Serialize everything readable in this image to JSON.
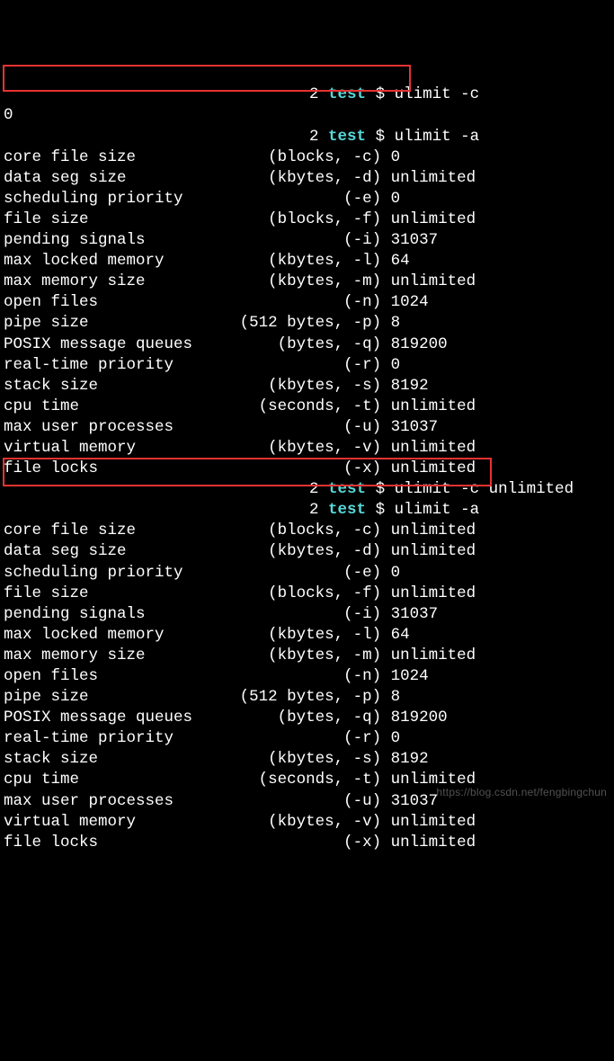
{
  "prompt": {
    "num": "2",
    "dir": "test",
    "sep": "$"
  },
  "commands": {
    "ulimit_c": "ulimit -c",
    "ulimit_a": "ulimit -a",
    "ulimit_c_unlimited": "ulimit -c unlimited"
  },
  "output0": "0",
  "limits1": [
    {
      "label": "core file size",
      "unit": "(blocks, -c)",
      "value": "0"
    },
    {
      "label": "data seg size",
      "unit": "(kbytes, -d)",
      "value": "unlimited"
    },
    {
      "label": "scheduling priority",
      "unit": "(-e)",
      "value": "0"
    },
    {
      "label": "file size",
      "unit": "(blocks, -f)",
      "value": "unlimited"
    },
    {
      "label": "pending signals",
      "unit": "(-i)",
      "value": "31037"
    },
    {
      "label": "max locked memory",
      "unit": "(kbytes, -l)",
      "value": "64"
    },
    {
      "label": "max memory size",
      "unit": "(kbytes, -m)",
      "value": "unlimited"
    },
    {
      "label": "open files",
      "unit": "(-n)",
      "value": "1024"
    },
    {
      "label": "pipe size",
      "unit": "(512 bytes, -p)",
      "value": "8"
    },
    {
      "label": "POSIX message queues",
      "unit": "(bytes, -q)",
      "value": "819200"
    },
    {
      "label": "real-time priority",
      "unit": "(-r)",
      "value": "0"
    },
    {
      "label": "stack size",
      "unit": "(kbytes, -s)",
      "value": "8192"
    },
    {
      "label": "cpu time",
      "unit": "(seconds, -t)",
      "value": "unlimited"
    },
    {
      "label": "max user processes",
      "unit": "(-u)",
      "value": "31037"
    },
    {
      "label": "virtual memory",
      "unit": "(kbytes, -v)",
      "value": "unlimited"
    },
    {
      "label": "file locks",
      "unit": "(-x)",
      "value": "unlimited"
    }
  ],
  "limits2": [
    {
      "label": "core file size",
      "unit": "(blocks, -c)",
      "value": "unlimited"
    },
    {
      "label": "data seg size",
      "unit": "(kbytes, -d)",
      "value": "unlimited"
    },
    {
      "label": "scheduling priority",
      "unit": "(-e)",
      "value": "0"
    },
    {
      "label": "file size",
      "unit": "(blocks, -f)",
      "value": "unlimited"
    },
    {
      "label": "pending signals",
      "unit": "(-i)",
      "value": "31037"
    },
    {
      "label": "max locked memory",
      "unit": "(kbytes, -l)",
      "value": "64"
    },
    {
      "label": "max memory size",
      "unit": "(kbytes, -m)",
      "value": "unlimited"
    },
    {
      "label": "open files",
      "unit": "(-n)",
      "value": "1024"
    },
    {
      "label": "pipe size",
      "unit": "(512 bytes, -p)",
      "value": "8"
    },
    {
      "label": "POSIX message queues",
      "unit": "(bytes, -q)",
      "value": "819200"
    },
    {
      "label": "real-time priority",
      "unit": "(-r)",
      "value": "0"
    },
    {
      "label": "stack size",
      "unit": "(kbytes, -s)",
      "value": "8192"
    },
    {
      "label": "cpu time",
      "unit": "(seconds, -t)",
      "value": "unlimited"
    },
    {
      "label": "max user processes",
      "unit": "(-u)",
      "value": "31037"
    },
    {
      "label": "virtual memory",
      "unit": "(kbytes, -v)",
      "value": "unlimited"
    },
    {
      "label": "file locks",
      "unit": "(-x)",
      "value": "unlimited"
    }
  ],
  "watermark": "https://blog.csdn.net/fengbingchun"
}
